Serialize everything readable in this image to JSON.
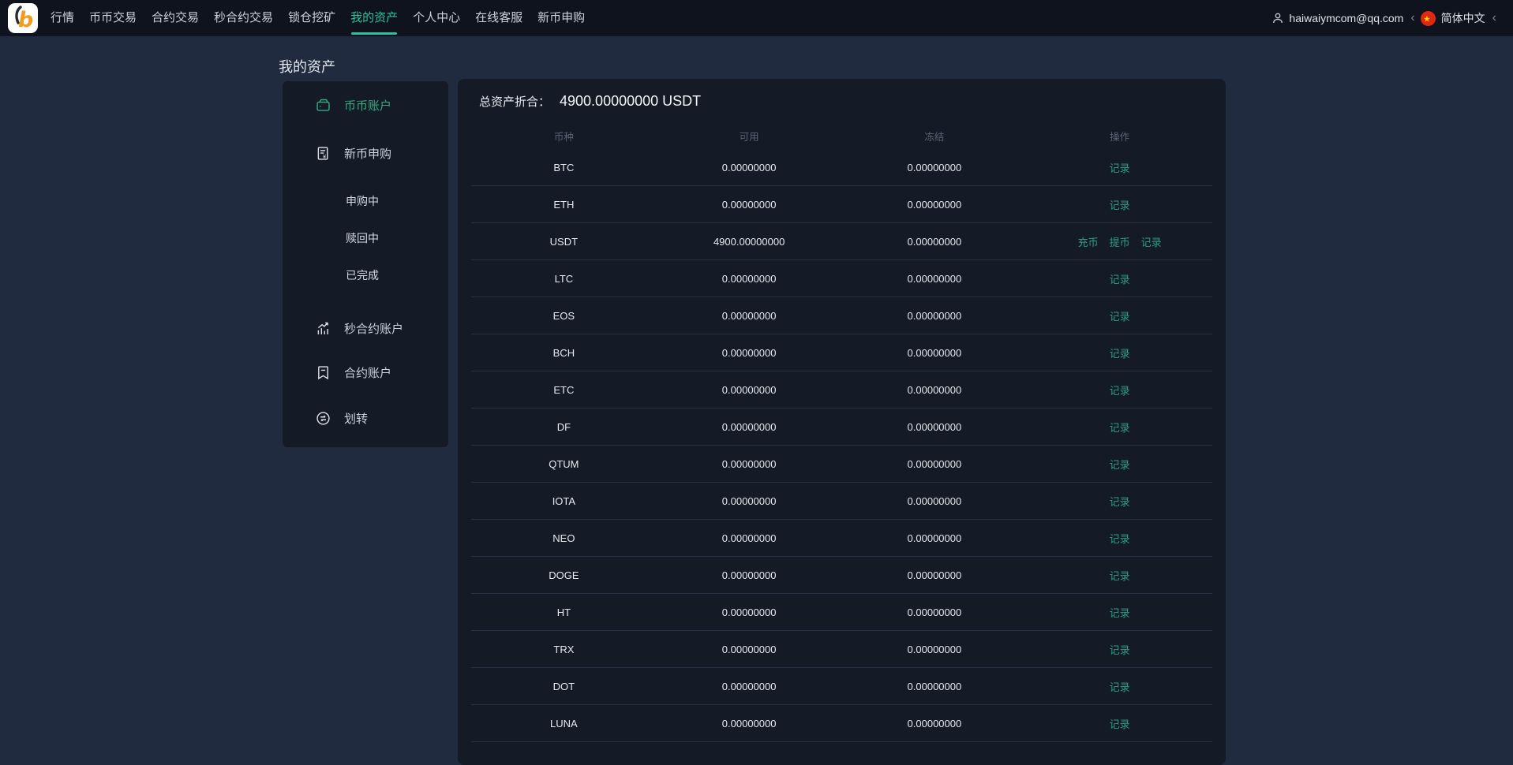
{
  "nav": {
    "items": [
      {
        "name": "market",
        "label": "行情"
      },
      {
        "name": "spot-trading",
        "label": "币币交易"
      },
      {
        "name": "contract-trading",
        "label": "合约交易"
      },
      {
        "name": "seconds-contract-trading",
        "label": "秒合约交易"
      },
      {
        "name": "lockup-mining",
        "label": "锁仓挖矿"
      },
      {
        "name": "my-assets",
        "label": "我的资产",
        "active": true
      },
      {
        "name": "user-center",
        "label": "个人中心"
      },
      {
        "name": "online-service",
        "label": "在线客服"
      },
      {
        "name": "new-coin-subscription",
        "label": "新币申购"
      }
    ],
    "user_email": "haiwaiymcom@qq.com",
    "language": "简体中文",
    "chevron": "‹"
  },
  "page": {
    "title": "我的资产"
  },
  "sidebar": {
    "items": [
      {
        "name": "coin-account",
        "label": "币币账户",
        "icon": "wallet-icon",
        "active": true
      },
      {
        "name": "new-coin-subscription",
        "label": "新币申购",
        "icon": "doc-currency-icon"
      },
      {
        "name": "subscribing",
        "label": "申购中",
        "sub": true
      },
      {
        "name": "redeeming",
        "label": "赎回中",
        "sub": true
      },
      {
        "name": "completed",
        "label": "已完成",
        "sub": true
      },
      {
        "name": "seconds-contract-account",
        "label": "秒合约账户",
        "icon": "bar-chart-icon"
      },
      {
        "name": "contract-account",
        "label": "合约账户",
        "icon": "contract-doc-icon"
      },
      {
        "name": "transfer",
        "label": "划转",
        "icon": "transfer-icon"
      }
    ]
  },
  "assets": {
    "total_label": "总资产折合：",
    "total_value": "4900.00000000 USDT",
    "columns": [
      "币种",
      "可用",
      "冻结",
      "操作"
    ],
    "action_labels": {
      "deposit": "充币",
      "withdraw": "提币",
      "records": "记录"
    },
    "rows": [
      {
        "coin": "BTC",
        "available": "0.00000000",
        "frozen": "0.00000000",
        "actions": [
          "records"
        ]
      },
      {
        "coin": "ETH",
        "available": "0.00000000",
        "frozen": "0.00000000",
        "actions": [
          "records"
        ]
      },
      {
        "coin": "USDT",
        "available": "4900.00000000",
        "frozen": "0.00000000",
        "actions": [
          "deposit",
          "withdraw",
          "records"
        ]
      },
      {
        "coin": "LTC",
        "available": "0.00000000",
        "frozen": "0.00000000",
        "actions": [
          "records"
        ]
      },
      {
        "coin": "EOS",
        "available": "0.00000000",
        "frozen": "0.00000000",
        "actions": [
          "records"
        ]
      },
      {
        "coin": "BCH",
        "available": "0.00000000",
        "frozen": "0.00000000",
        "actions": [
          "records"
        ]
      },
      {
        "coin": "ETC",
        "available": "0.00000000",
        "frozen": "0.00000000",
        "actions": [
          "records"
        ]
      },
      {
        "coin": "DF",
        "available": "0.00000000",
        "frozen": "0.00000000",
        "actions": [
          "records"
        ]
      },
      {
        "coin": "QTUM",
        "available": "0.00000000",
        "frozen": "0.00000000",
        "actions": [
          "records"
        ]
      },
      {
        "coin": "IOTA",
        "available": "0.00000000",
        "frozen": "0.00000000",
        "actions": [
          "records"
        ]
      },
      {
        "coin": "NEO",
        "available": "0.00000000",
        "frozen": "0.00000000",
        "actions": [
          "records"
        ]
      },
      {
        "coin": "DOGE",
        "available": "0.00000000",
        "frozen": "0.00000000",
        "actions": [
          "records"
        ]
      },
      {
        "coin": "HT",
        "available": "0.00000000",
        "frozen": "0.00000000",
        "actions": [
          "records"
        ]
      },
      {
        "coin": "TRX",
        "available": "0.00000000",
        "frozen": "0.00000000",
        "actions": [
          "records"
        ]
      },
      {
        "coin": "DOT",
        "available": "0.00000000",
        "frozen": "0.00000000",
        "actions": [
          "records"
        ]
      },
      {
        "coin": "LUNA",
        "available": "0.00000000",
        "frozen": "0.00000000",
        "actions": [
          "records"
        ]
      }
    ]
  },
  "colors": {
    "accent": "#2cc29c",
    "link_green": "#2f9e82",
    "sidebar_active": "#35ab7f",
    "navbar_bg": "#0e131d",
    "page_bg": "#212b3f",
    "panel_bg": "#141b27",
    "divider": "#273249",
    "logo_orange": "#f29b1d",
    "flag_red": "#de2910",
    "flag_yellow": "#ffde00"
  }
}
